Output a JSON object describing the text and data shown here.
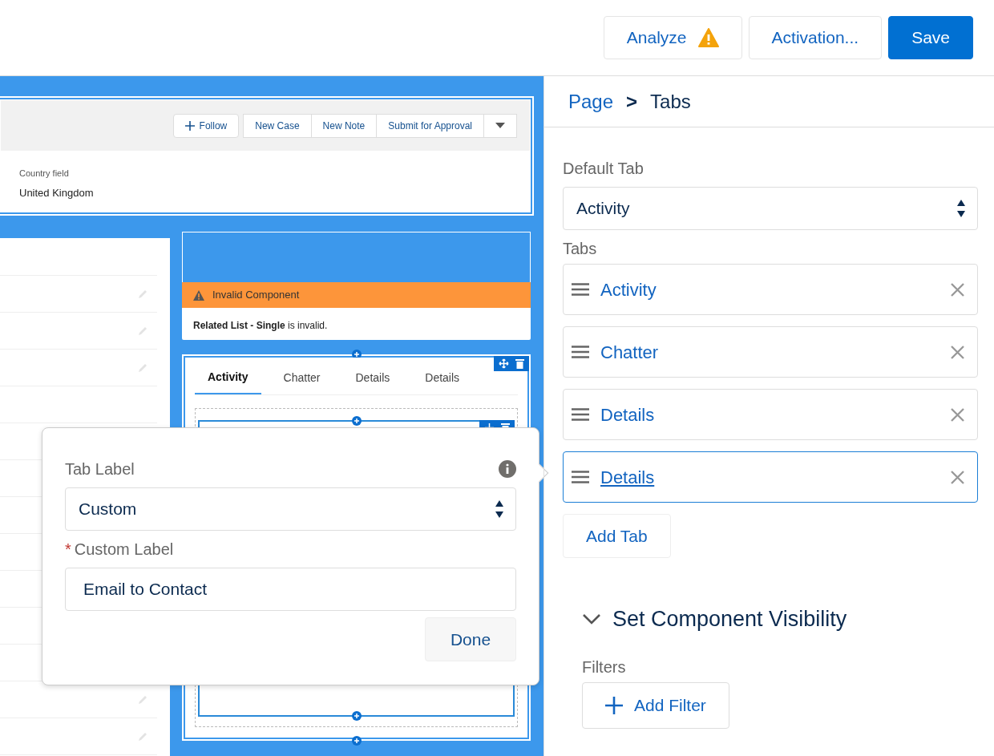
{
  "toolbar": {
    "buttons": [
      {
        "label": "Analyze",
        "kind": "warning"
      },
      {
        "label": "Activation...",
        "kind": "neutral"
      },
      {
        "label": "Save",
        "kind": "brand"
      }
    ]
  },
  "canvas": {
    "header_actions": [
      {
        "label": "Follow",
        "kind": "follow"
      },
      {
        "label": "New Case",
        "kind": "plain"
      },
      {
        "label": "New Note",
        "kind": "plain"
      },
      {
        "label": "Submit for Approval",
        "kind": "plain"
      },
      {
        "kind": "menu"
      }
    ],
    "field": {
      "label": "Country field",
      "value": "United Kingdom"
    },
    "error": {
      "title": "Invalid Component",
      "message": "**Related List - Single** is invalid."
    },
    "tabs": [
      {
        "label": "Activity",
        "selected": true
      },
      {
        "label": "Chatter",
        "selected": false
      },
      {
        "label": "Details",
        "selected": false
      },
      {
        "label": "Details",
        "selected": false
      }
    ]
  },
  "popover": {
    "tab_label": {
      "label": "Tab Label",
      "value": "Custom"
    },
    "custom_label": {
      "label": "Custom Label",
      "required_mark": "*",
      "value": "Email to Contact"
    },
    "done": "Done"
  },
  "panel": {
    "breadcrumb": {
      "parent": "Page",
      "separator": ">",
      "current": "Tabs"
    },
    "default_tab": {
      "label": "Default Tab",
      "value": "Activity"
    },
    "tabs_label": "Tabs",
    "tabs": [
      {
        "label": "Activity",
        "selected": false
      },
      {
        "label": "Chatter",
        "selected": false
      },
      {
        "label": "Details",
        "selected": false
      },
      {
        "label": "Details",
        "selected": true
      }
    ],
    "add_tab": "Add Tab",
    "visibility": {
      "title": "Set Component Visibility",
      "expanded": true,
      "filters_label": "Filters",
      "add_filter": "Add Filter"
    }
  }
}
